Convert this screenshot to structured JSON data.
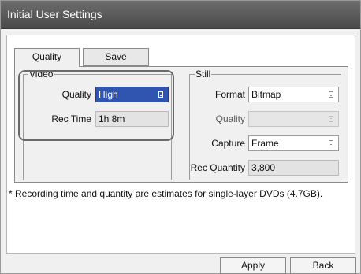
{
  "window": {
    "title": "Initial User Settings"
  },
  "tabs": [
    {
      "label": "Quality",
      "active": true
    },
    {
      "label": "Save",
      "active": false
    }
  ],
  "video": {
    "legend": "Video",
    "quality": {
      "label": "Quality",
      "value": "High"
    },
    "rec_time": {
      "label": "Rec Time",
      "value": "1h 8m"
    }
  },
  "still": {
    "legend": "Still",
    "format": {
      "label": "Format",
      "value": "Bitmap"
    },
    "quality": {
      "label": "Quality",
      "value": ""
    },
    "capture": {
      "label": "Capture",
      "value": "Frame"
    },
    "rec_quantity": {
      "label": "Rec Quantity",
      "value": "3,800"
    }
  },
  "note": "* Recording time and quantity are estimates for single-layer DVDs (4.7GB).",
  "buttons": {
    "apply": "Apply",
    "back": "Back"
  },
  "colors": {
    "title_bar": "#545454",
    "active_select": "#2f55b0"
  }
}
